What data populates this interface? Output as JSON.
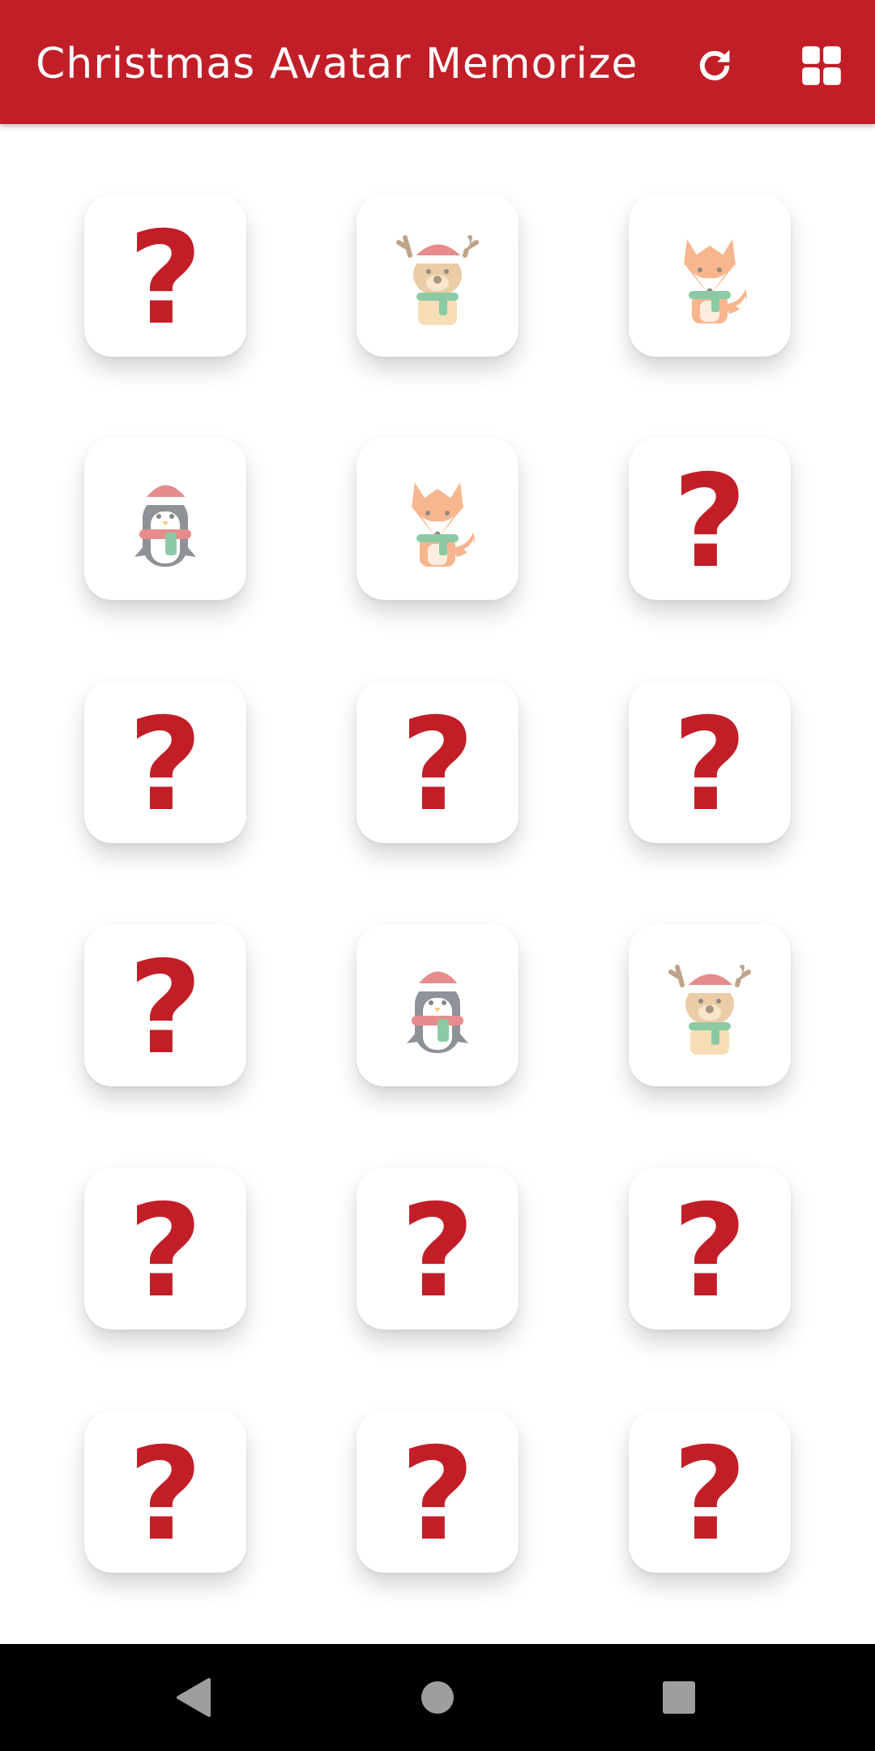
{
  "app": {
    "title": "Christmas Avatar Memorize",
    "actions": [
      {
        "name": "refresh-icon"
      },
      {
        "name": "grid-icon"
      }
    ]
  },
  "colors": {
    "accent": "#c21e27",
    "card_background": "#ffffff",
    "question_mark": "#c21e27",
    "nav_bar": "#000000"
  },
  "board": {
    "rows": 6,
    "columns": 3,
    "cards": [
      {
        "state": "hidden",
        "face": "?",
        "icon": "question-mark-icon"
      },
      {
        "state": "revealed",
        "face": "",
        "icon": "reindeer-icon"
      },
      {
        "state": "revealed",
        "face": "",
        "icon": "fox-icon"
      },
      {
        "state": "revealed",
        "face": "",
        "icon": "penguin-icon"
      },
      {
        "state": "revealed",
        "face": "",
        "icon": "fox-icon"
      },
      {
        "state": "hidden",
        "face": "?",
        "icon": "question-mark-icon"
      },
      {
        "state": "hidden",
        "face": "?",
        "icon": "question-mark-icon"
      },
      {
        "state": "hidden",
        "face": "?",
        "icon": "question-mark-icon"
      },
      {
        "state": "hidden",
        "face": "?",
        "icon": "question-mark-icon"
      },
      {
        "state": "hidden",
        "face": "?",
        "icon": "question-mark-icon"
      },
      {
        "state": "revealed",
        "face": "",
        "icon": "penguin-icon"
      },
      {
        "state": "revealed",
        "face": "",
        "icon": "reindeer-icon"
      },
      {
        "state": "hidden",
        "face": "?",
        "icon": "question-mark-icon"
      },
      {
        "state": "hidden",
        "face": "?",
        "icon": "question-mark-icon"
      },
      {
        "state": "hidden",
        "face": "?",
        "icon": "question-mark-icon"
      },
      {
        "state": "hidden",
        "face": "?",
        "icon": "question-mark-icon"
      },
      {
        "state": "hidden",
        "face": "?",
        "icon": "question-mark-icon"
      },
      {
        "state": "hidden",
        "face": "?",
        "icon": "question-mark-icon"
      }
    ]
  },
  "navigation": {
    "buttons": [
      {
        "name": "back-icon"
      },
      {
        "name": "home-icon"
      },
      {
        "name": "recents-icon"
      }
    ]
  }
}
